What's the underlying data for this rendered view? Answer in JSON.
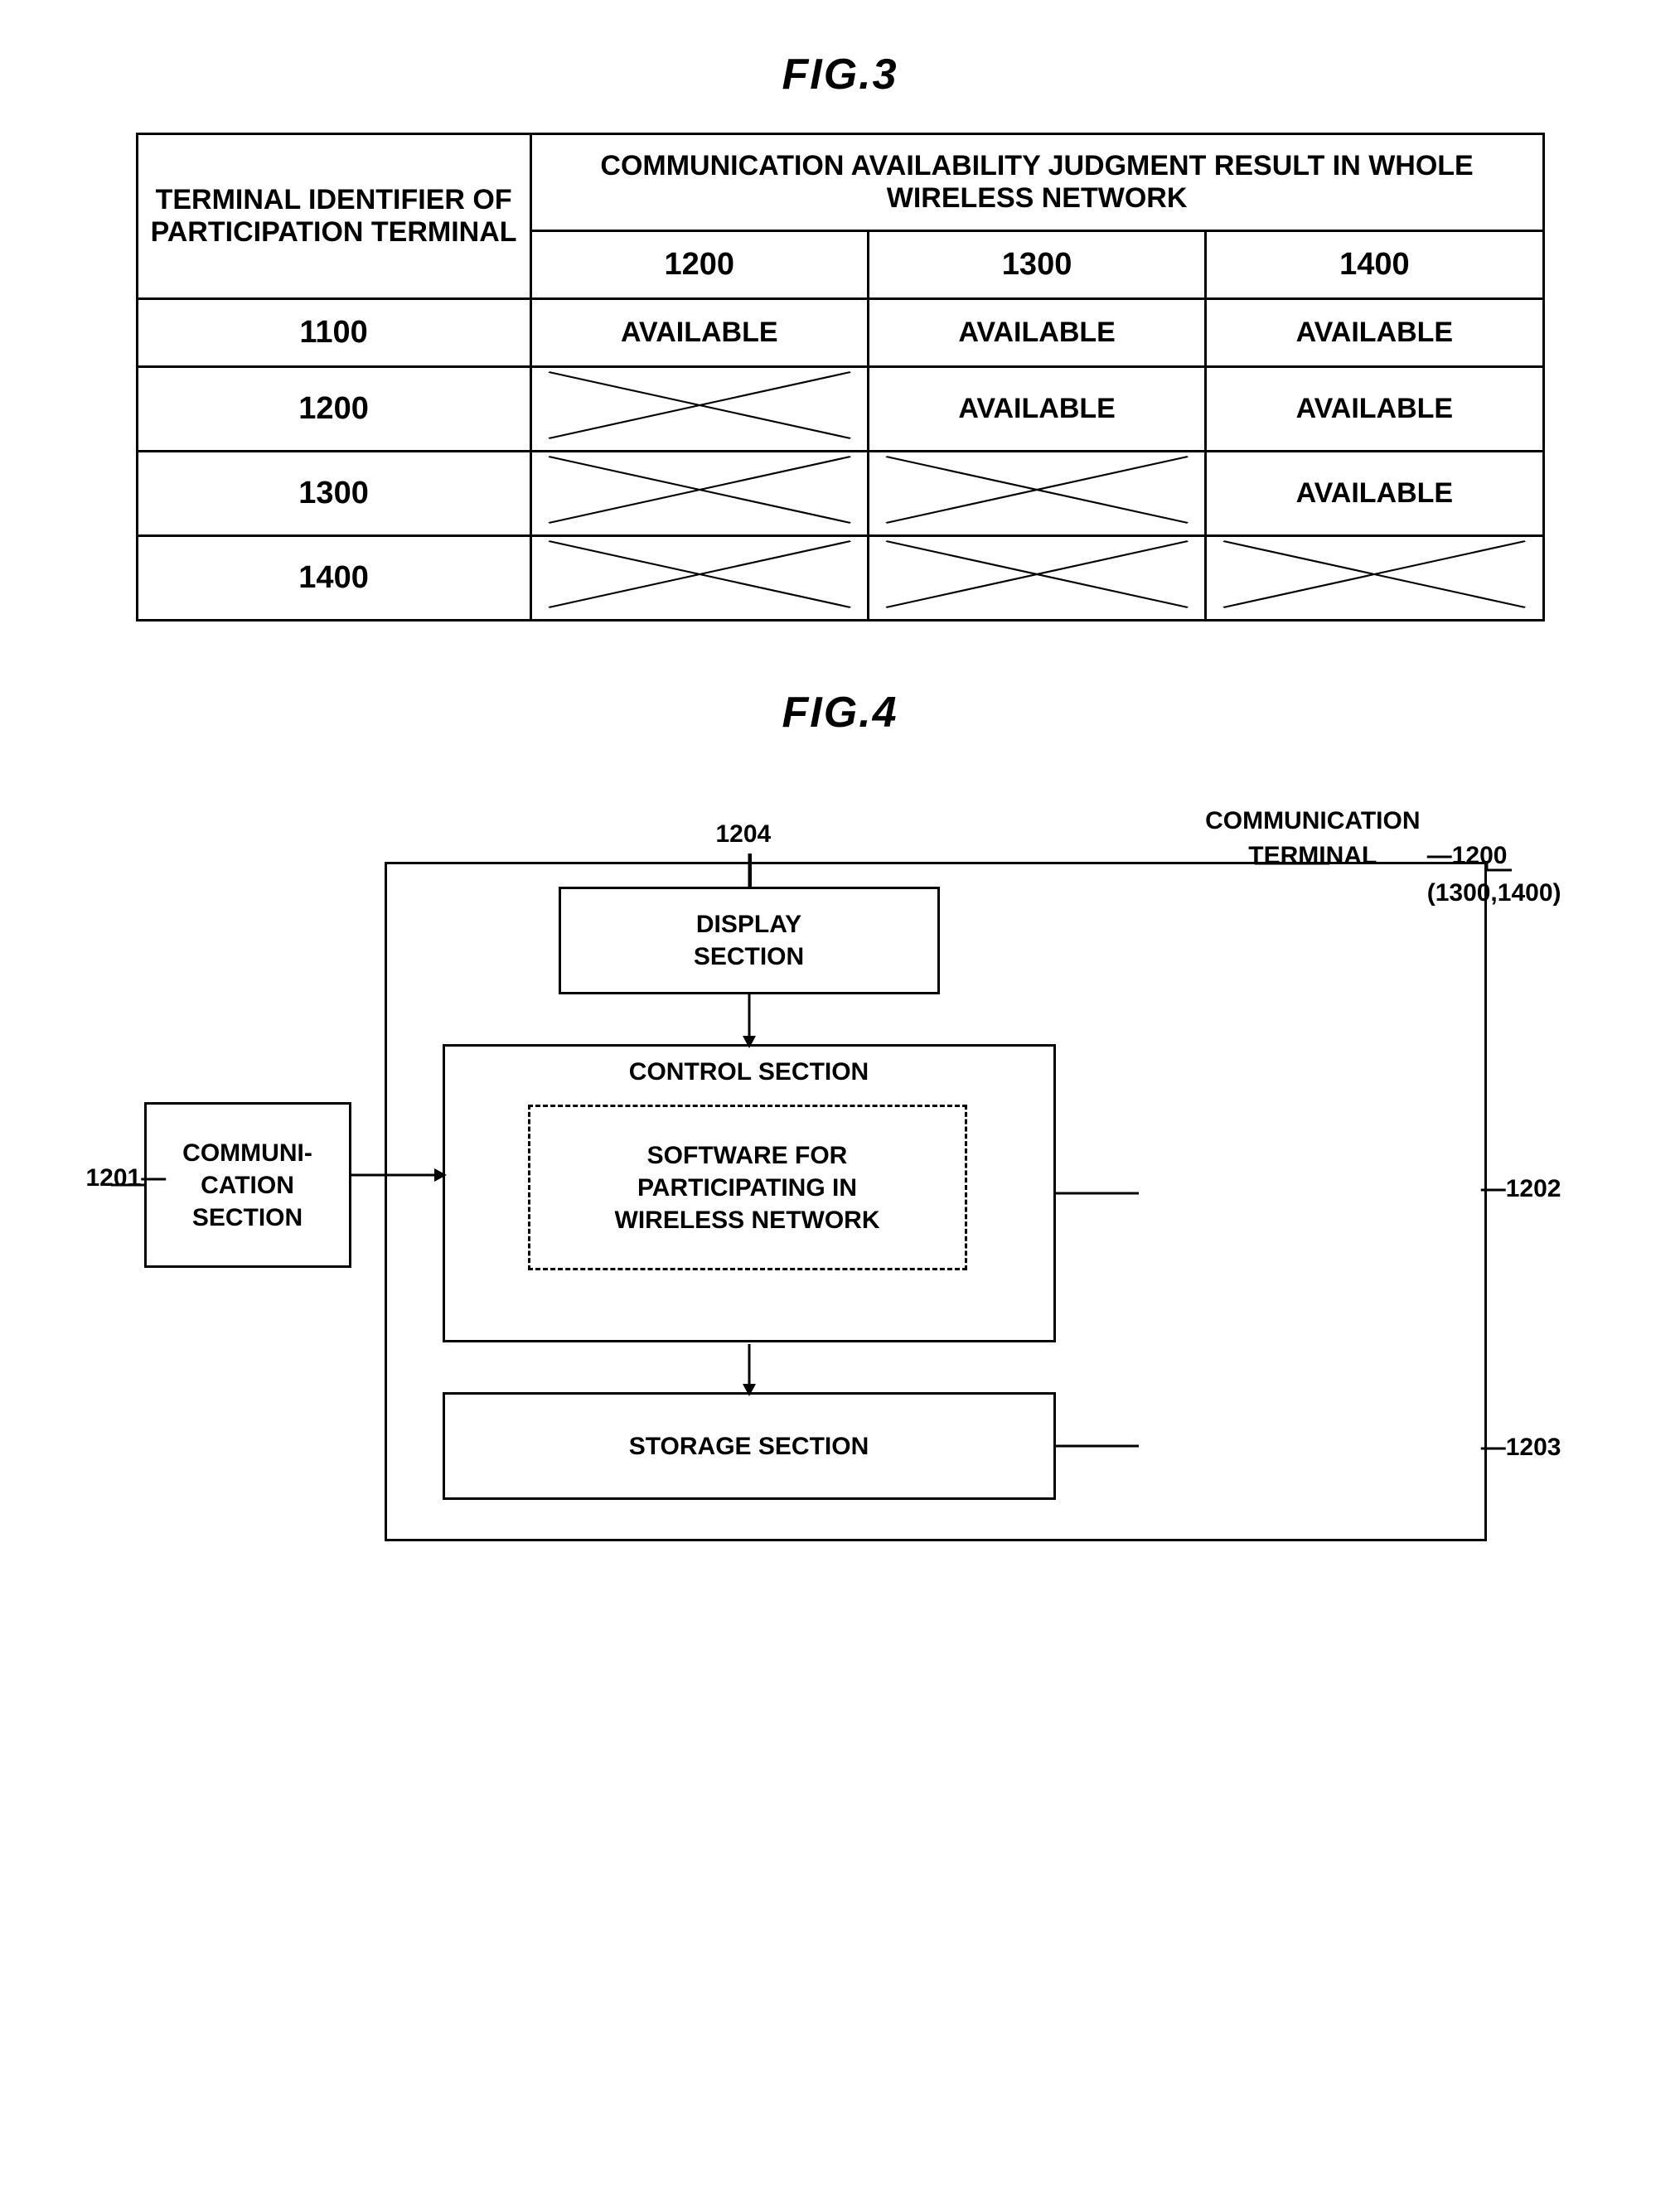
{
  "fig3": {
    "title": "FIG.3",
    "col_header_left": "TERMINAL IDENTIFIER OF PARTICIPATION TERMINAL",
    "col_header_right": "COMMUNICATION AVAILABILITY JUDGMENT RESULT IN WHOLE WIRELESS NETWORK",
    "subheaders": [
      "1200",
      "1300",
      "1400"
    ],
    "rows": [
      {
        "id": "1100",
        "cells": [
          "AVAILABLE",
          "AVAILABLE",
          "AVAILABLE"
        ]
      },
      {
        "id": "1200",
        "cells": [
          "X",
          "AVAILABLE",
          "AVAILABLE"
        ]
      },
      {
        "id": "1300",
        "cells": [
          "X",
          "X",
          "AVAILABLE"
        ]
      },
      {
        "id": "1400",
        "cells": [
          "X",
          "X",
          "X"
        ]
      }
    ]
  },
  "fig4": {
    "title": "FIG.4",
    "label_1204": "1204",
    "label_comm_terminal": "COMMUNICATION\nTERMINAL",
    "display_section_label": "DISPLAY\nSECTION",
    "control_section_label": "CONTROL SECTION",
    "software_label": "SOFTWARE FOR\nPARTICIPATING IN\nWIRLESS NETWORK",
    "storage_section_label": "STORAGE SECTION",
    "comm_section_label": "COMMUNI-\nCATION\nSECTION",
    "ref_1200": "~1200\n(1300,1400)",
    "ref_1201": "1201~",
    "ref_1202": "~1202",
    "ref_1203": "~1203"
  }
}
